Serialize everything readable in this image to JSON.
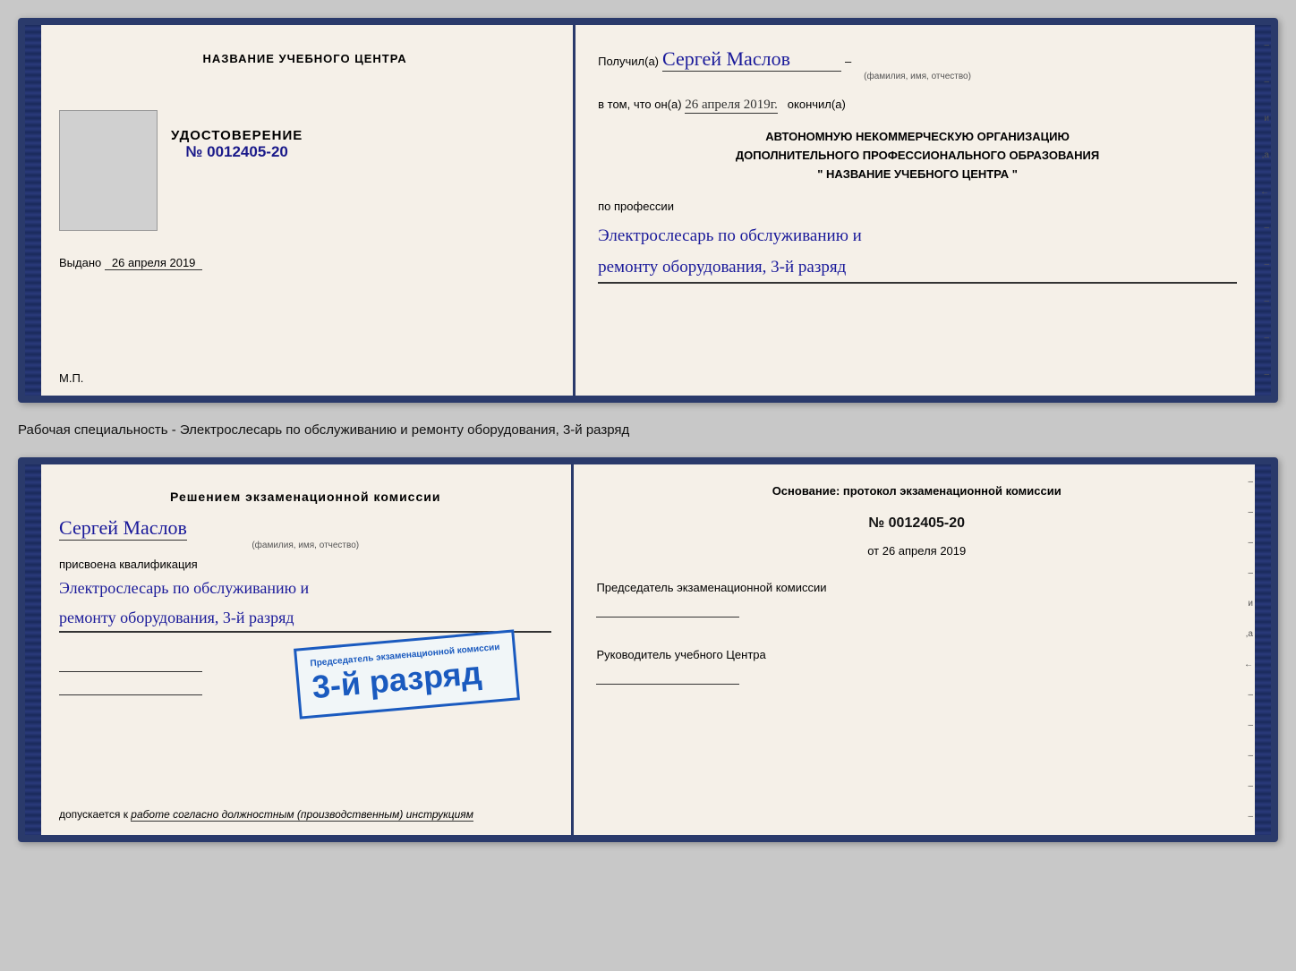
{
  "cert1": {
    "left": {
      "org_name": "НАЗВАНИЕ УЧЕБНОГО ЦЕНТРА",
      "udost_title": "УДОСТОВЕРЕНИЕ",
      "udost_number": "№ 0012405-20",
      "issued_label": "Выдано",
      "issued_date": "26 апреля 2019",
      "mp_label": "М.П."
    },
    "right": {
      "received_label": "Получил(а)",
      "recipient_name": "Сергей Маслов",
      "fio_label": "(фамилия, имя, отчество)",
      "vtom_label": "в том, что он(а)",
      "date_value": "26 апреля 2019г.",
      "okончил_label": "окончил(а)",
      "org_line1": "АВТОНОМНУЮ НЕКОММЕРЧЕСКУЮ ОРГАНИЗАЦИЮ",
      "org_line2": "ДОПОЛНИТЕЛЬНОГО ПРОФЕССИОНАЛЬНОГО ОБРАЗОВАНИЯ",
      "org_line3": "\"   НАЗВАНИЕ УЧЕБНОГО ЦЕНТРА   \"",
      "po_professii": "по профессии",
      "profession_line1": "Электрослесарь по обслуживанию и",
      "profession_line2": "ремонту оборудования, 3-й разряд"
    }
  },
  "middle_text": "Рабочая специальность - Электрослесарь по обслуживанию и ремонту оборудования, 3-й разряд",
  "cert2": {
    "left": {
      "resheniyem_title": "Решением экзаменационной  комиссии",
      "name": "Сергей Маслов",
      "fio_label": "(фамилия, имя, отчество)",
      "prisvoena": "присвоена квалификация",
      "qual_line1": "Электрослесарь по обслуживанию и",
      "qual_line2": "ремонту оборудования, 3-й разряд",
      "dopuskaetsya_prefix": "допускается к",
      "dopuskaetsya_italic": "работе согласно должностным (производственным) инструкциям"
    },
    "stamp": {
      "title": "Председатель экзаменационной комиссии",
      "main_text": "3-й разряд"
    },
    "right": {
      "osnovanie_title": "Основание: протокол экзаменационной  комиссии",
      "doc_number": "№  0012405-20",
      "doc_date_prefix": "от",
      "doc_date": "26 апреля 2019",
      "predsedatel_label": "Председатель экзаменационной комиссии",
      "rukovoditel_label": "Руководитель учебного Центра"
    }
  }
}
